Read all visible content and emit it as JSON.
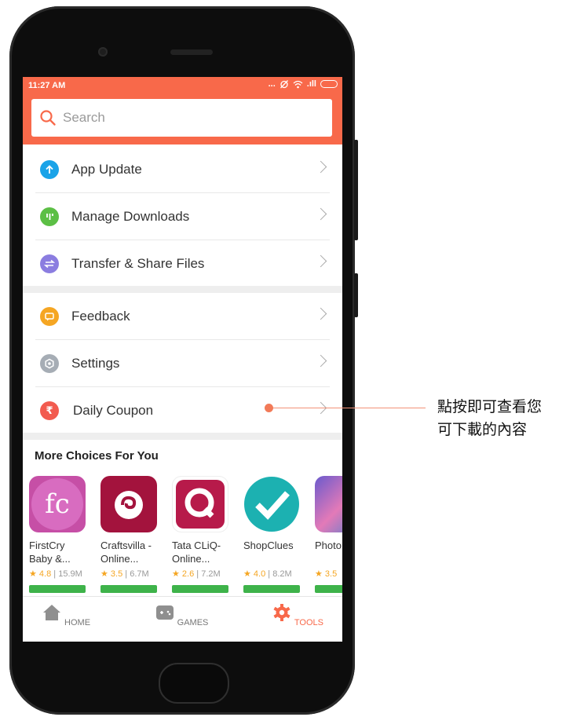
{
  "status_bar": {
    "time": "11:27 AM",
    "dots": "...",
    "signal": ".ıll"
  },
  "search": {
    "placeholder": "Search"
  },
  "menu_group_1": [
    {
      "label": "App Update",
      "icon": "arrow-up-icon",
      "color": "#1aa3e8"
    },
    {
      "label": "Manage Downloads",
      "icon": "download-icon",
      "color": "#5cbf45"
    },
    {
      "label": "Transfer & Share Files",
      "icon": "transfer-icon",
      "color": "#8b7de0"
    }
  ],
  "menu_group_2": [
    {
      "label": "Feedback",
      "icon": "chat-icon",
      "color": "#f5a623"
    },
    {
      "label": "Settings",
      "icon": "gear-icon",
      "color": "#a6adb5"
    },
    {
      "label": "Daily Coupon",
      "icon": "rupee-icon",
      "color": "#f25b4f"
    }
  ],
  "section_title": "More Choices For You",
  "apps": [
    {
      "name": "FirstCry Baby &...",
      "rating": "4.8",
      "size": "15.9M",
      "icon": "firstcry-icon"
    },
    {
      "name": "Craftsvilla - Online...",
      "rating": "3.5",
      "size": "6.7M",
      "icon": "craftsvilla-icon"
    },
    {
      "name": "Tata CLiQ- Online...",
      "rating": "2.6",
      "size": "7.2M",
      "icon": "tatacliq-icon"
    },
    {
      "name": "ShopClues",
      "rating": "4.0",
      "size": "8.2M",
      "icon": "shopclues-icon"
    },
    {
      "name": "Photo",
      "rating": "3.5",
      "size": "",
      "icon": "photo-app-icon"
    }
  ],
  "tabs": [
    {
      "label": "HOME",
      "icon": "home-icon"
    },
    {
      "label": "GAMES",
      "icon": "gamepad-icon"
    },
    {
      "label": "TOOLS",
      "icon": "gear-icon"
    }
  ],
  "callout": {
    "line1": "點按即可查看您",
    "line2": "可下載的內容"
  },
  "colors": {
    "accent": "#f8694a",
    "install": "#3eb34a",
    "rating": "#f5a623"
  }
}
